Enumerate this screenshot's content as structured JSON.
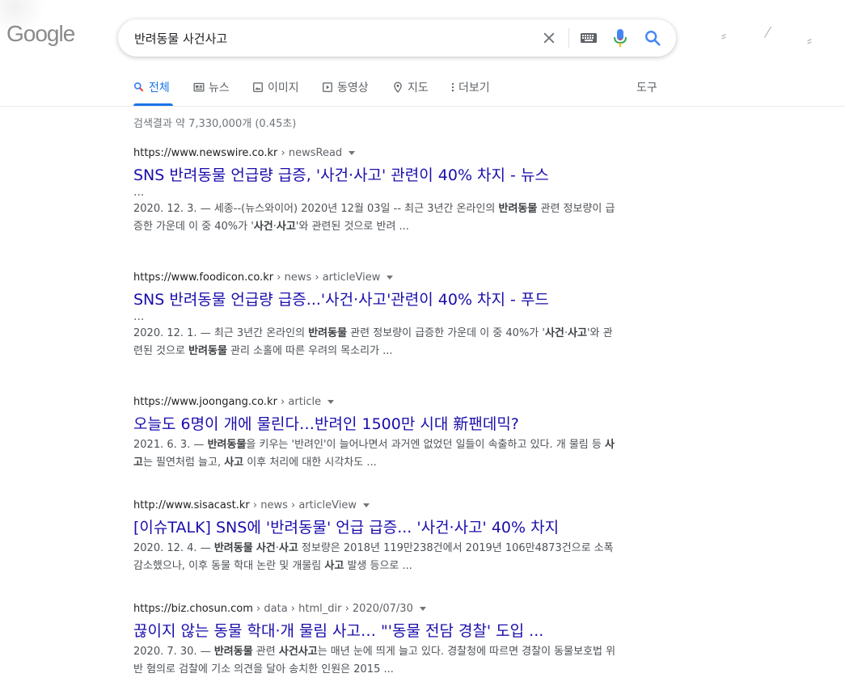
{
  "header": {
    "logo": "Google",
    "search": {
      "value": "반려동물 사건사고"
    }
  },
  "tabs": [
    {
      "label": "전체",
      "icon": "search-icon",
      "active": true
    },
    {
      "label": "뉴스",
      "icon": "news-icon"
    },
    {
      "label": "이미지",
      "icon": "image-icon"
    },
    {
      "label": "동영상",
      "icon": "video-icon"
    },
    {
      "label": "지도",
      "icon": "map-pin-icon"
    },
    {
      "label": "더보기",
      "icon": "more-vert-icon"
    }
  ],
  "tools_label": "도구",
  "stats": "검색결과 약 7,330,000개 (0.45초)",
  "results": [
    {
      "domain": "https://www.newswire.co.kr",
      "path": " › newsRead",
      "title": "SNS 반려동물 언급량 급증, '사건·사고' 관련이 40% 차지 - 뉴스",
      "ellipsis": "...",
      "date": "2020. 12. 3. — ",
      "snippet": [
        {
          "t": "세종--(뉴스와이어) 2020년 12월 03일 -- 최근 3년간 온라인의 "
        },
        {
          "t": "반려동물",
          "b": true
        },
        {
          "t": " 관련 정보량이 급증한 가운데 이 중 40%가 '"
        },
        {
          "t": "사건",
          "b": true
        },
        {
          "t": "·"
        },
        {
          "t": "사고",
          "b": true
        },
        {
          "t": "'와 관련된 것으로 반려 ..."
        }
      ]
    },
    {
      "domain": "https://www.foodicon.co.kr",
      "path": " › news › articleView",
      "title": "SNS 반려동물 언급량 급증...'사건·사고'관련이 40% 차지 - 푸드",
      "ellipsis": "...",
      "date": "2020. 12. 1. — ",
      "snippet": [
        {
          "t": "최근 3년간 온라인의 "
        },
        {
          "t": "반려동물",
          "b": true
        },
        {
          "t": " 관련 정보량이 급증한 가운데 이 중 40%가 '"
        },
        {
          "t": "사건",
          "b": true
        },
        {
          "t": "·"
        },
        {
          "t": "사고",
          "b": true
        },
        {
          "t": "'와 관련된 것으로 "
        },
        {
          "t": "반려동물",
          "b": true
        },
        {
          "t": " 관리 소홀에 따른 우려의 목소리가 ..."
        }
      ]
    },
    {
      "domain": "https://www.joongang.co.kr",
      "path": " › article",
      "title": "오늘도 6명이 개에 물린다…반려인 1500만 시대 新팬데믹?",
      "date": "2021. 6. 3. — ",
      "snippet": [
        {
          "t": "반려동물",
          "b": true
        },
        {
          "t": "을 키우는 '반려인'이 늘어나면서 과거엔 없었던 일들이 속출하고 있다. 개 물림 등 "
        },
        {
          "t": "사고",
          "b": true
        },
        {
          "t": "는 필연처럼 늘고, "
        },
        {
          "t": "사고",
          "b": true
        },
        {
          "t": " 이후 처리에 대한 시각차도 ..."
        }
      ]
    },
    {
      "domain": "http://www.sisacast.kr",
      "path": " › news › articleView",
      "title": "[이슈TALK] SNS에 '반려동물' 언급 급증... '사건·사고' 40% 차지",
      "date": "2020. 12. 4. — ",
      "snippet": [
        {
          "t": "반려동물",
          "b": true
        },
        {
          "t": " "
        },
        {
          "t": "사건",
          "b": true
        },
        {
          "t": "·"
        },
        {
          "t": "사고",
          "b": true
        },
        {
          "t": " 정보량은 2018년 119만238건에서 2019년 106만4873건으로 소폭 감소했으나, 이후 동물 학대 논란 및 개물림 "
        },
        {
          "t": "사고",
          "b": true
        },
        {
          "t": " 발생 등으로 ..."
        }
      ]
    },
    {
      "domain": "https://biz.chosun.com",
      "path": " › data › html_dir › 2020/07/30",
      "title": "끊이지 않는 동물 학대·개 물림 사고… \"'동물 전담 경찰' 도입 ...",
      "date": "2020. 7. 30. — ",
      "snippet": [
        {
          "t": "반려동물",
          "b": true
        },
        {
          "t": " 관련 "
        },
        {
          "t": "사건사고",
          "b": true
        },
        {
          "t": "는 매년 눈에 띄게 늘고 있다. 경찰청에 따르면 경찰이 동물보호법 위반 혐의로 검찰에 기소 의견을 달아 송치한 인원은 2015 ..."
        }
      ]
    }
  ]
}
